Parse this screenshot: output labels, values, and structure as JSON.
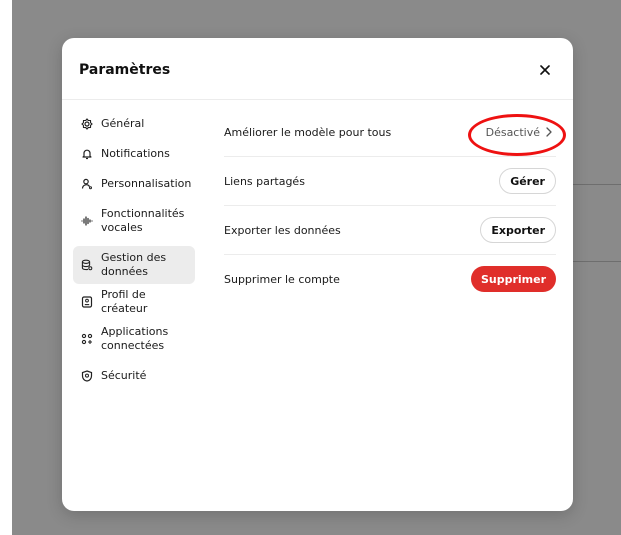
{
  "modal": {
    "title": "Paramètres",
    "close_icon": "close-icon"
  },
  "sidebar": {
    "items": [
      {
        "label": "Général",
        "icon": "gear-icon"
      },
      {
        "label": "Notifications",
        "icon": "bell-icon"
      },
      {
        "label": "Personnalisation",
        "icon": "person-icon"
      },
      {
        "label": "Fonctionnalités vocales",
        "icon": "waveform-icon"
      },
      {
        "label": "Gestion des données",
        "icon": "database-icon",
        "active": true
      },
      {
        "label": "Profil de créateur",
        "icon": "profile-card-icon"
      },
      {
        "label": "Applications connectées",
        "icon": "apps-grid-icon"
      },
      {
        "label": "Sécurité",
        "icon": "shield-icon"
      }
    ]
  },
  "content": {
    "rows": [
      {
        "label": "Améliorer le modèle pour tous",
        "value": "Désactivé",
        "control": "select"
      },
      {
        "label": "Liens partagés",
        "button": "Gérer"
      },
      {
        "label": "Exporter les données",
        "button": "Exporter"
      },
      {
        "label": "Supprimer le compte",
        "button": "Supprimer",
        "danger": true
      }
    ]
  },
  "colors": {
    "danger": "#e02e2a",
    "annotation": "#ee1111",
    "overlay": "#8a8a8a"
  }
}
